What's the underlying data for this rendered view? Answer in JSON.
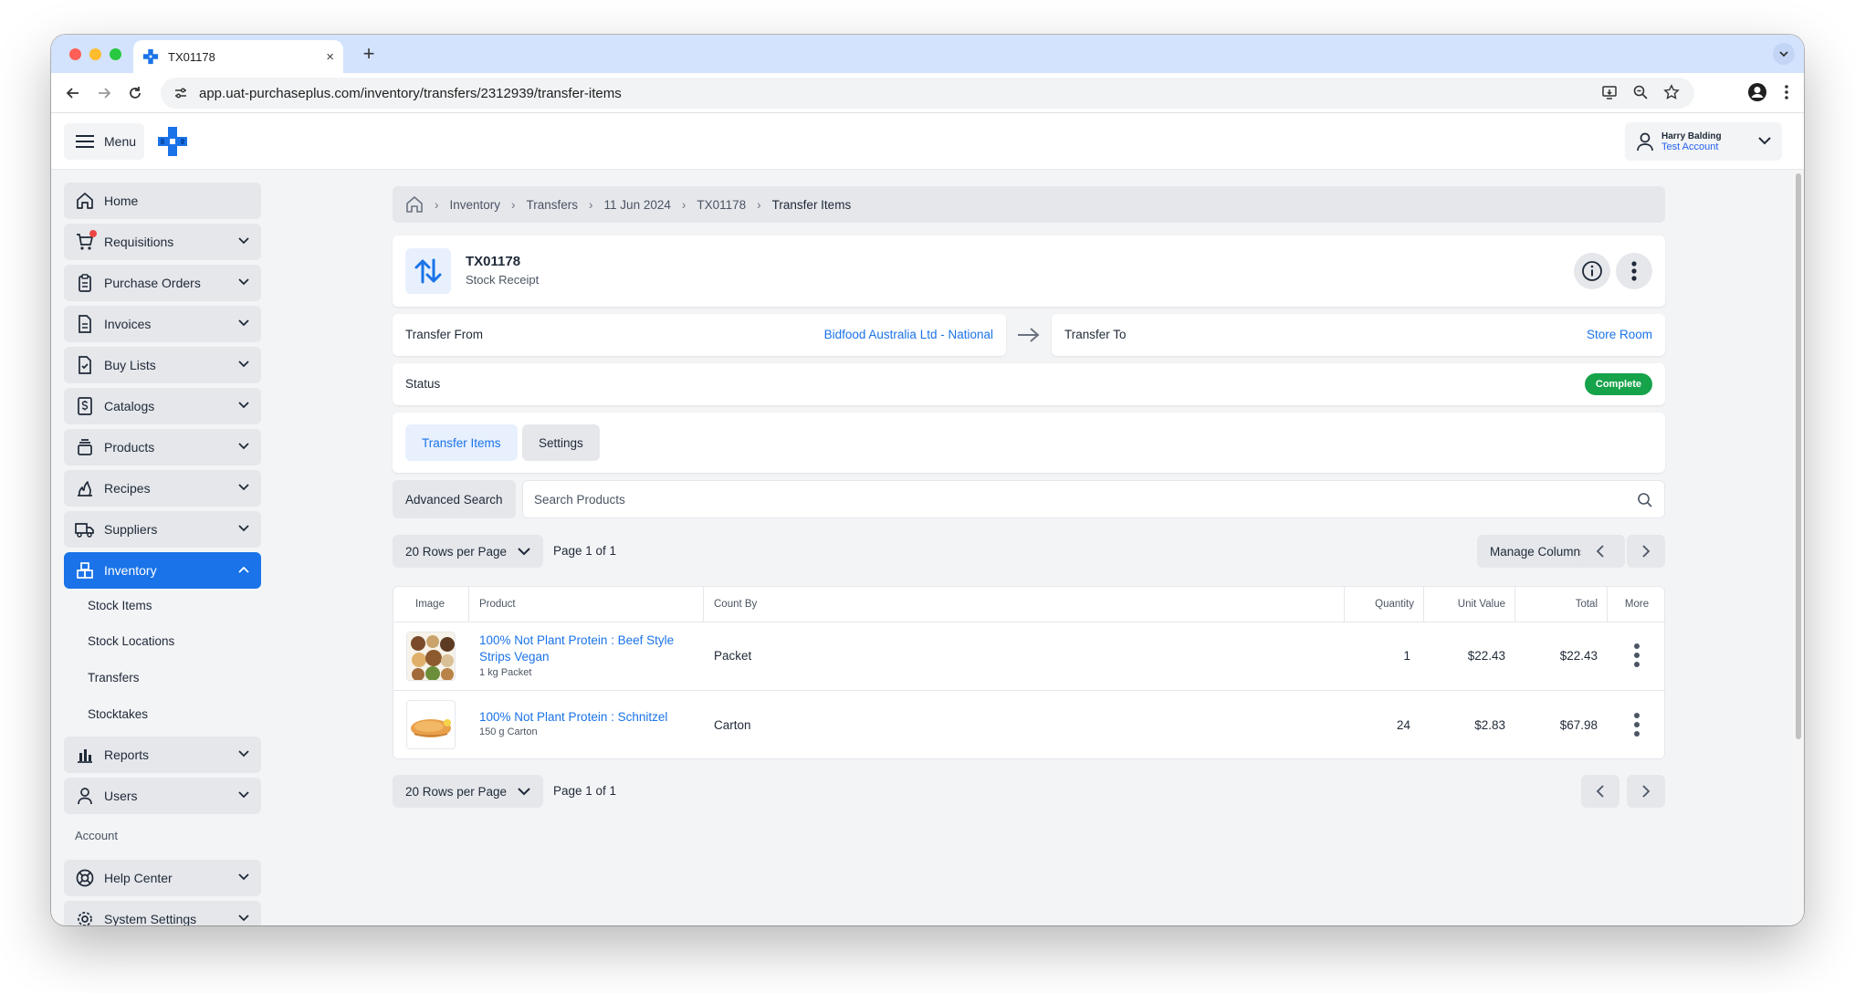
{
  "browser": {
    "tab_title": "TX01178",
    "url": "app.uat-purchaseplus.com/inventory/transfers/2312939/transfer-items",
    "new_tab_symbol": "+",
    "close_symbol": "×"
  },
  "topbar": {
    "menu_label": "Menu",
    "user_name": "Harry Balding",
    "user_account": "Test Account"
  },
  "sidebar": {
    "items": [
      {
        "label": "Home",
        "icon": "home-icon"
      },
      {
        "label": "Requisitions",
        "icon": "cart-icon"
      },
      {
        "label": "Purchase Orders",
        "icon": "clipboard-icon"
      },
      {
        "label": "Invoices",
        "icon": "document-icon"
      },
      {
        "label": "Buy Lists",
        "icon": "checklist-icon"
      },
      {
        "label": "Catalogs",
        "icon": "dollar-doc-icon"
      },
      {
        "label": "Products",
        "icon": "stack-icon"
      },
      {
        "label": "Recipes",
        "icon": "flame-icon"
      },
      {
        "label": "Suppliers",
        "icon": "truck-icon"
      },
      {
        "label": "Inventory",
        "icon": "boxes-icon"
      },
      {
        "label": "Reports",
        "icon": "bar-chart-icon"
      },
      {
        "label": "Users",
        "icon": "user-icon"
      },
      {
        "label": "Help Center",
        "icon": "lifebuoy-icon"
      },
      {
        "label": "System Settings",
        "icon": "gear-icon"
      }
    ],
    "inventory_sub": [
      "Stock Items",
      "Stock Locations",
      "Transfers",
      "Stocktakes"
    ],
    "account_heading": "Account"
  },
  "breadcrumb": [
    "Inventory",
    "Transfers",
    "11 Jun 2024",
    "TX01178",
    "Transfer Items"
  ],
  "header": {
    "title": "TX01178",
    "subtitle": "Stock Receipt"
  },
  "transfer": {
    "from_label": "Transfer From",
    "from_value": "Bidfood Australia Ltd - National",
    "to_label": "Transfer To",
    "to_value": "Store Room",
    "status_label": "Status",
    "status_value": "Complete",
    "status_color": "#16a34a"
  },
  "tabs": [
    "Transfer Items",
    "Settings"
  ],
  "search": {
    "advanced_label": "Advanced Search",
    "placeholder": "Search Products"
  },
  "pagination": {
    "rows_label": "20 Rows per Page",
    "page_label": "Page 1 of 1",
    "manage_columns": "Manage Columns"
  },
  "table": {
    "columns": [
      "Image",
      "Product",
      "Count By",
      "Quantity",
      "Unit Value",
      "Total",
      "More"
    ],
    "rows": [
      {
        "product": "100% Not Plant Protein : Beef Style Strips Vegan",
        "product_line1": "100% Not Plant Protein : Beef Style",
        "product_line2": "Strips Vegan",
        "size": "1 kg Packet",
        "count_by": "Packet",
        "quantity": "1",
        "unit_value": "$22.43",
        "total": "$22.43"
      },
      {
        "product": "100% Not Plant Protein : Schnitzel",
        "product_line1": "100% Not Plant Protein : Schnitzel",
        "product_line2": "",
        "size": "150 g Carton",
        "count_by": "Carton",
        "quantity": "24",
        "unit_value": "$2.83",
        "total": "$67.98"
      }
    ]
  },
  "colors": {
    "accent": "#1a73e8",
    "chrome": "#d3e3fd"
  }
}
